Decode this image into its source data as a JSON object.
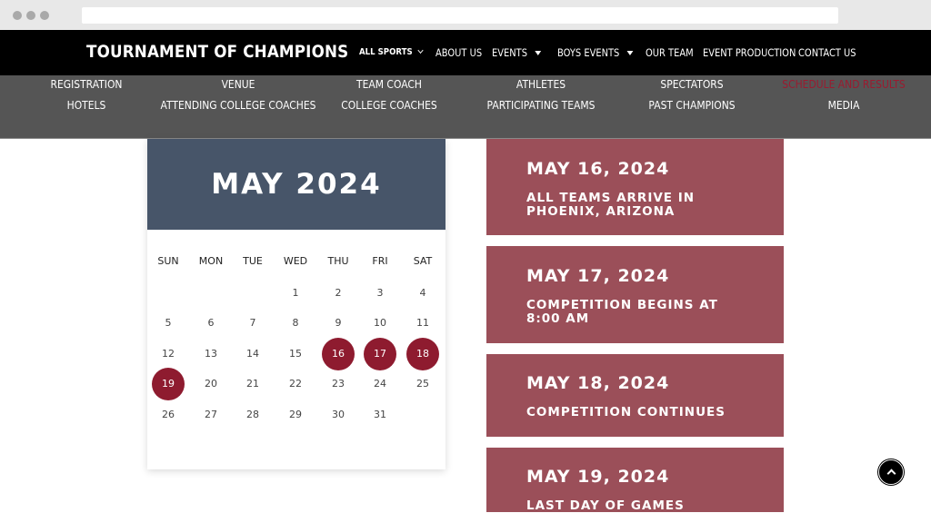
{
  "header": {
    "brand": "TOURNAMENT OF CHAMPIONS",
    "nav": [
      {
        "label": "ALL SPORTS"
      },
      {
        "label": "ABOUT US"
      },
      {
        "label": "EVENTS"
      },
      {
        "label": "BOYS EVENTS"
      },
      {
        "label": "OUR TEAM"
      },
      {
        "label": "EVENT PRODUCTION"
      },
      {
        "label": "CONTACT US"
      }
    ]
  },
  "subnav": {
    "row1": [
      "REGISTRATION",
      "VENUE",
      "TEAM COACH",
      "ATHLETES",
      "SPECTATORS",
      "SCHEDULE AND RESULTS"
    ],
    "row2": [
      "HOTELS",
      "ATTENDING COLLEGE COACHES",
      "COLLEGE COACHES",
      "PARTICIPATING TEAMS",
      "PAST CHAMPIONS",
      "MEDIA"
    ],
    "active_color": "#9a1b30"
  },
  "calendar": {
    "title": "MAY 2024",
    "weekdays": [
      "SUN",
      "MON",
      "TUE",
      "WED",
      "THU",
      "FRI",
      "SAT"
    ],
    "weeks": [
      [
        "",
        "",
        "",
        "1",
        "2",
        "3",
        "4"
      ],
      [
        "5",
        "6",
        "7",
        "8",
        "9",
        "10",
        "11"
      ],
      [
        "12",
        "13",
        "14",
        "15",
        "16",
        "17",
        "18"
      ],
      [
        "19",
        "20",
        "21",
        "22",
        "23",
        "24",
        "25"
      ],
      [
        "26",
        "27",
        "28",
        "29",
        "30",
        "31",
        ""
      ]
    ],
    "highlighted_days": [
      "16",
      "17",
      "18",
      "19"
    ],
    "highlight_color": "#8e1b2f",
    "header_color": "#475569"
  },
  "events": [
    {
      "date": "MAY 16, 2024",
      "description": "ALL TEAMS ARRIVE IN PHOENIX, ARIZONA"
    },
    {
      "date": "MAY 17, 2024",
      "description": "COMPETITION BEGINS AT 8:00 AM"
    },
    {
      "date": "MAY 18, 2024",
      "description": "COMPETITION CONTINUES"
    },
    {
      "date": "MAY 19, 2024",
      "description": "LAST DAY OF GAMES"
    }
  ],
  "event_color": "#9b4f59",
  "scroll_top_icon": "chevron-up-icon"
}
